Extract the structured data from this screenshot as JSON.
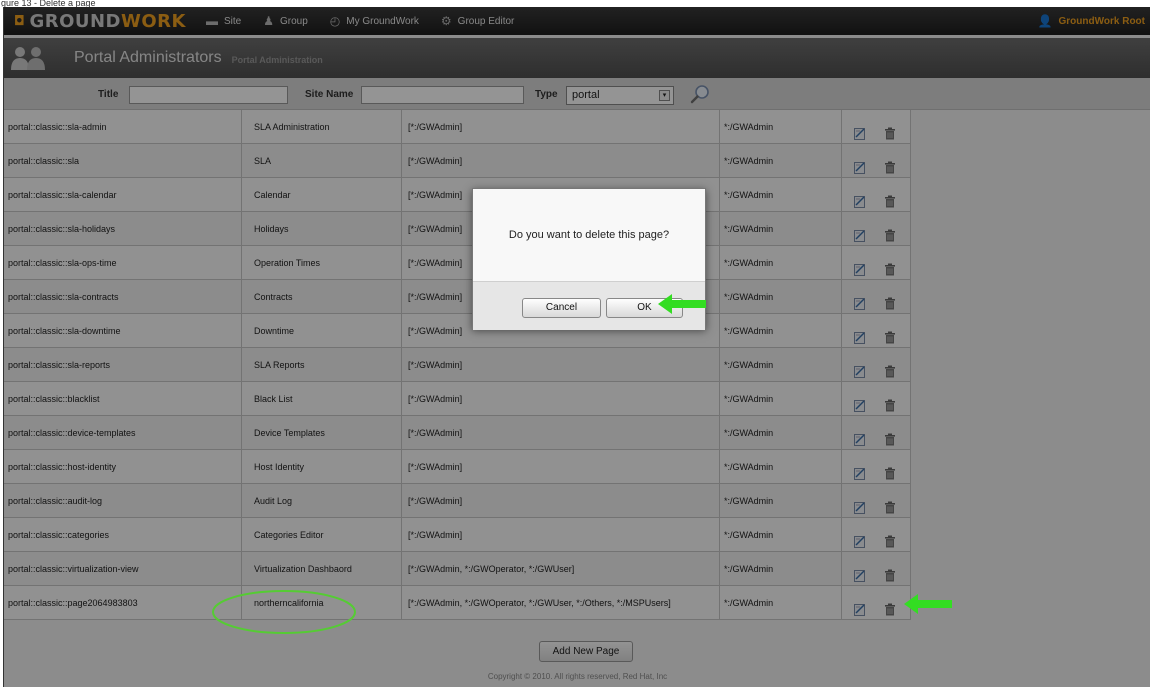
{
  "caption": "gure 13 - Delete a page",
  "topbar": {
    "logo_prefix": "GROUND",
    "logo_highlight": "WORK",
    "nav": [
      {
        "label": "Site",
        "icon": "site-icon"
      },
      {
        "label": "Group",
        "icon": "group-icon"
      },
      {
        "label": "My GroundWork",
        "icon": "dashboard-icon"
      },
      {
        "label": "Group Editor",
        "icon": "gears-icon"
      }
    ],
    "user": "GroundWork Root"
  },
  "portal": {
    "title": "Portal Administrators",
    "subtitle": "Portal Administration"
  },
  "search": {
    "title_label": "Title",
    "title_value": "",
    "site_name_label": "Site Name",
    "site_name_value": "",
    "type_label": "Type",
    "type_value": "portal"
  },
  "table": {
    "rows": [
      {
        "id": "portal::classic::sla-admin",
        "title": "SLA Administration",
        "access": "[*:/GWAdmin]",
        "edit": "*:/GWAdmin"
      },
      {
        "id": "portal::classic::sla",
        "title": "SLA",
        "access": "[*:/GWAdmin]",
        "edit": "*:/GWAdmin"
      },
      {
        "id": "portal::classic::sla-calendar",
        "title": "Calendar",
        "access": "[*:/GWAdmin]",
        "edit": "*:/GWAdmin"
      },
      {
        "id": "portal::classic::sla-holidays",
        "title": "Holidays",
        "access": "[*:/GWAdmin]",
        "edit": "*:/GWAdmin"
      },
      {
        "id": "portal::classic::sla-ops-time",
        "title": "Operation Times",
        "access": "[*:/GWAdmin]",
        "edit": "*:/GWAdmin"
      },
      {
        "id": "portal::classic::sla-contracts",
        "title": "Contracts",
        "access": "[*:/GWAdmin]",
        "edit": "*:/GWAdmin"
      },
      {
        "id": "portal::classic::sla-downtime",
        "title": "Downtime",
        "access": "[*:/GWAdmin]",
        "edit": "*:/GWAdmin"
      },
      {
        "id": "portal::classic::sla-reports",
        "title": "SLA Reports",
        "access": "[*:/GWAdmin]",
        "edit": "*:/GWAdmin"
      },
      {
        "id": "portal::classic::blacklist",
        "title": "Black List",
        "access": "[*:/GWAdmin]",
        "edit": "*:/GWAdmin"
      },
      {
        "id": "portal::classic::device-templates",
        "title": "Device Templates",
        "access": "[*:/GWAdmin]",
        "edit": "*:/GWAdmin"
      },
      {
        "id": "portal::classic::host-identity",
        "title": "Host Identity",
        "access": "[*:/GWAdmin]",
        "edit": "*:/GWAdmin"
      },
      {
        "id": "portal::classic::audit-log",
        "title": "Audit Log",
        "access": "[*:/GWAdmin]",
        "edit": "*:/GWAdmin"
      },
      {
        "id": "portal::classic::categories",
        "title": "Categories Editor",
        "access": "[*:/GWAdmin]",
        "edit": "*:/GWAdmin"
      },
      {
        "id": "portal::classic::virtualization-view",
        "title": "Virtualization Dashbaord",
        "access": "[*:/GWAdmin, *:/GWOperator, *:/GWUser]",
        "edit": "*:/GWAdmin"
      },
      {
        "id": "portal::classic::page2064983803",
        "title": "northerncalifornia",
        "access": "[*:/GWAdmin, *:/GWOperator, *:/GWUser, *:/Others, *:/MSPUsers]",
        "edit": "*:/GWAdmin"
      }
    ]
  },
  "add_button": "Add New Page",
  "copyright": "Copyright © 2010. All rights reserved, Red Hat, Inc",
  "dialog": {
    "message": "Do you want to delete this page?",
    "cancel": "Cancel",
    "ok": "OK"
  },
  "colors": {
    "accent": "#f0a020",
    "annotation_arrow": "#33dd22",
    "annotation_ellipse": "#55cc33"
  }
}
